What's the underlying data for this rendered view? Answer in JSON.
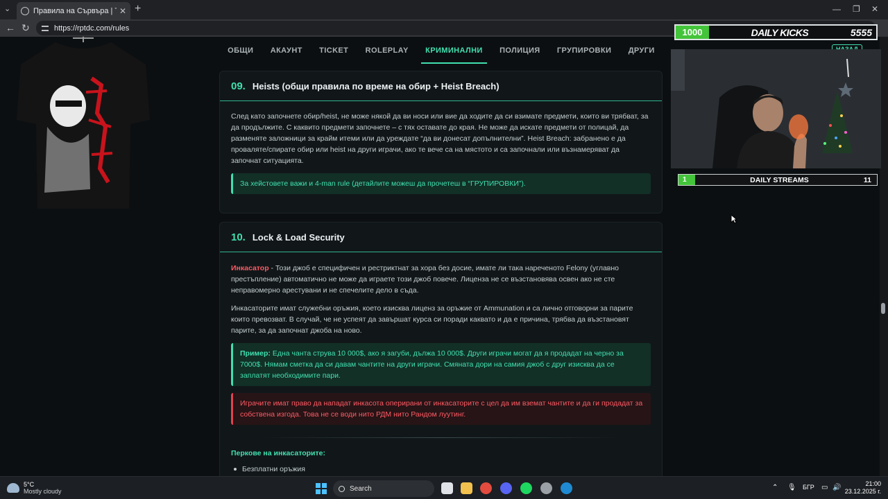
{
  "browser": {
    "tab_title": "Правила на Сървъра | TDC Rolep",
    "url": "https://rptdc.com/rules"
  },
  "nav": {
    "items": [
      "ОБЩИ",
      "АКАУНТ",
      "TICKET",
      "ROLEPLAY",
      "КРИМИНАЛНИ",
      "ПОЛИЦИЯ",
      "ГРУПИРОВКИ",
      "ДРУГИ"
    ],
    "active": "КРИМИНАЛНИ",
    "back_label": "НАЗАД"
  },
  "section9": {
    "number": "09.",
    "title": "Heists (общи правила по време на обир + Heist Breach)",
    "body": "След като започнете обир/heist, не може някой да ви носи или вие да ходите да си взимате предмети, които ви трябват, за да продължите. С каквито предмети започнете – с тях оставате до края. Не може да искате предмети от полицай, да разменяте заложници за крайм итеми или да уреждате “да ви донесат допълнителни”. Heist Breach: забранено е да проваляте/спирате обир или heist на други играчи, ако те вече са на мястото и са започнали или възнамеряват да започнат ситуацията.",
    "note": "За хейстовете важи и 4-man rule (детайлите можеш да прочетеш в “ГРУПИРОВКИ”)."
  },
  "section10": {
    "number": "10.",
    "title": "Lock & Load Security",
    "role": "Инкасатор",
    "p1": " - Този джоб е специфичен и рестриктнат за хора без досие, имате ли така нареченото Felony (углавно престъпление) автоматично не може да играете този джоб повече. Лиценза не се възстановява освен ако не сте неправомерно арестувани и не спечелите дело в съда.",
    "p2": "Инкасаторите имат служебни оръжия, което изисква лиценз за оръжие от Ammunation и са лично отговорни за парите които превозват. В случай, че не успеят да завършат курса си поради каквато и да е причина, трябва да възстановят парите, за да започнат джоба на ново.",
    "example_label": "Пример:",
    "example": " Една чанта струва 10 000$, ако я загуби, дължа 10 000$. Други играчи могат да я продадат на черно за 7000$. Нямам сметка да си давам чантите на други играчи. Смяната дори на самия джоб с друг изисква да се заплатят необходимите пари.",
    "warning": "Играчите имат право да нападат инкасота оперирани от инкасаторите с цел да им вземат чантите и да ги продадат за собствена изгода. Това не се води нито РДМ нито Рандом луутинг.",
    "perks_title": "Перкове на инкасаторите:",
    "perks": [
      "Безплатни оръжия"
    ]
  },
  "overlay": {
    "kicks_start": "1000",
    "kicks_label": "DAILY KICKS",
    "kicks_goal": "5555",
    "streams_start": "1",
    "streams_label": "DAILY STREAMS",
    "streams_goal": "11"
  },
  "taskbar": {
    "temp": "5°C",
    "weather": "Mostly cloudy",
    "search": "Search",
    "lang": "БГР",
    "time": "21:00",
    "date": "23.12.2025 г."
  },
  "colors": {
    "accent": "#41e0b0",
    "danger": "#ff5a64",
    "kicks_green": "#43c43a"
  }
}
